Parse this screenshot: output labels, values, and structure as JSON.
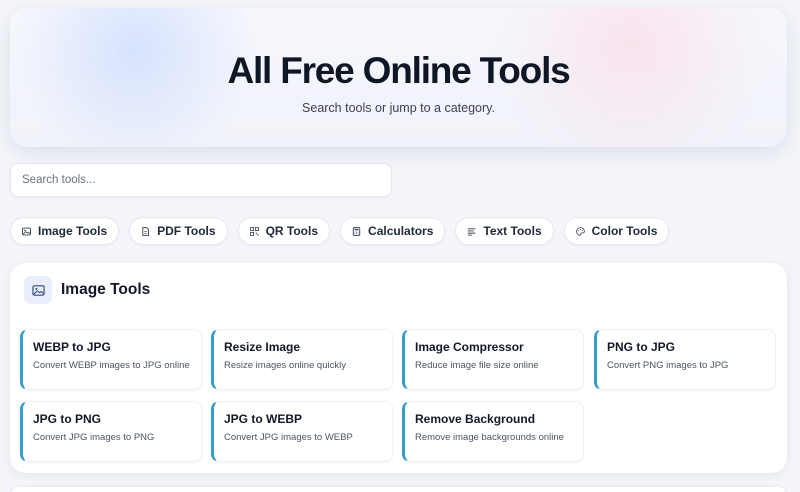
{
  "hero": {
    "title": "All Free Online Tools",
    "subtitle": "Search tools or jump to a category."
  },
  "search": {
    "placeholder": "Search tools..."
  },
  "categories": [
    {
      "label": "Image Tools",
      "icon": "image-icon"
    },
    {
      "label": "PDF Tools",
      "icon": "document-icon"
    },
    {
      "label": "QR Tools",
      "icon": "qr-icon"
    },
    {
      "label": "Calculators",
      "icon": "calculator-icon"
    },
    {
      "label": "Text Tools",
      "icon": "text-lines-icon"
    },
    {
      "label": "Color Tools",
      "icon": "palette-icon"
    }
  ],
  "section": {
    "title": "Image Tools",
    "icon": "image-icon",
    "tools": [
      {
        "name": "WEBP to JPG",
        "desc": "Convert WEBP images to JPG online"
      },
      {
        "name": "Resize Image",
        "desc": "Resize images online quickly"
      },
      {
        "name": "Image Compressor",
        "desc": "Reduce image file size online"
      },
      {
        "name": "PNG to JPG",
        "desc": "Convert PNG images to JPG"
      },
      {
        "name": "JPG to PNG",
        "desc": "Convert JPG images to PNG"
      },
      {
        "name": "JPG to WEBP",
        "desc": "Convert JPG images to WEBP"
      },
      {
        "name": "Remove Background",
        "desc": "Remove image backgrounds online"
      }
    ]
  },
  "colors": {
    "accent": "#3a9cc9",
    "heading": "#0f1626",
    "background": "#f3f5fa"
  }
}
